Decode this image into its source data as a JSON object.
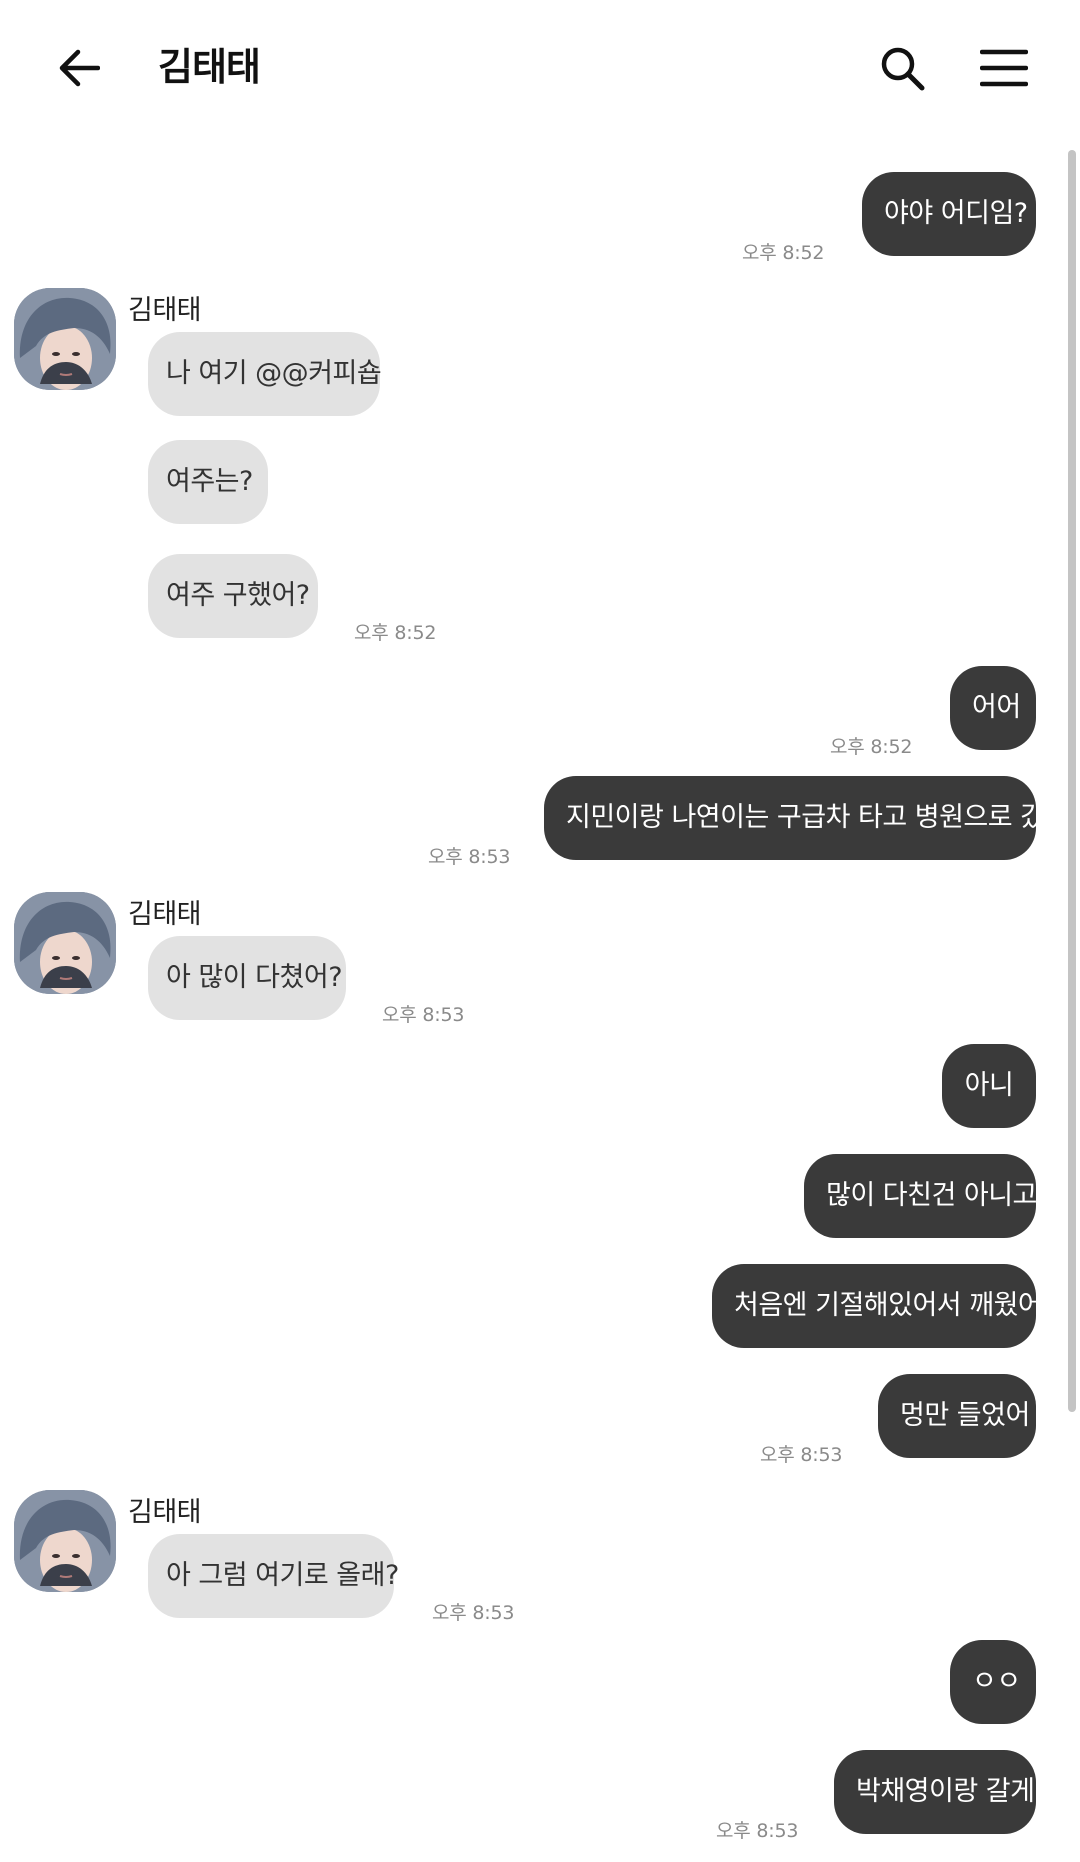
{
  "header": {
    "title": "김태태",
    "back_icon": "arrow-left-icon",
    "search_icon": "search-icon",
    "menu_icon": "hamburger-menu-icon"
  },
  "colors": {
    "outgoing_bubble": "#3a3a3a",
    "incoming_bubble": "#e2e2e2",
    "timestamp": "#8a8a8a",
    "scrollbar": "#c4c4c4"
  },
  "sender_name": "김태태",
  "messages": {
    "m1": "야야 어디임?",
    "m2": "나 여기 @@커피숍",
    "m3": "여주는?",
    "m4": "여주 구했어?",
    "m5": "어어",
    "m6": "지민이랑 나연이는 구급차 타고 병원으로 갔어",
    "m7": "아 많이 다쳤어?",
    "m8": "아니",
    "m9": "많이 다친건 아니고",
    "m10": "처음엔 기절해있어서 깨웠어",
    "m11": "멍만 들었어",
    "m12": "아 그럼 여기로 올래?",
    "m13": "ㅇㅇ",
    "m14": "박채영이랑 갈게"
  },
  "times": {
    "t1": "오후 8:52",
    "t2": "오후 8:52",
    "t3": "오후 8:52",
    "t4": "오후 8:53",
    "t5": "오후 8:53",
    "t6": "오후 8:53",
    "t7": "오후 8:53",
    "t8": "오후 8:53"
  }
}
